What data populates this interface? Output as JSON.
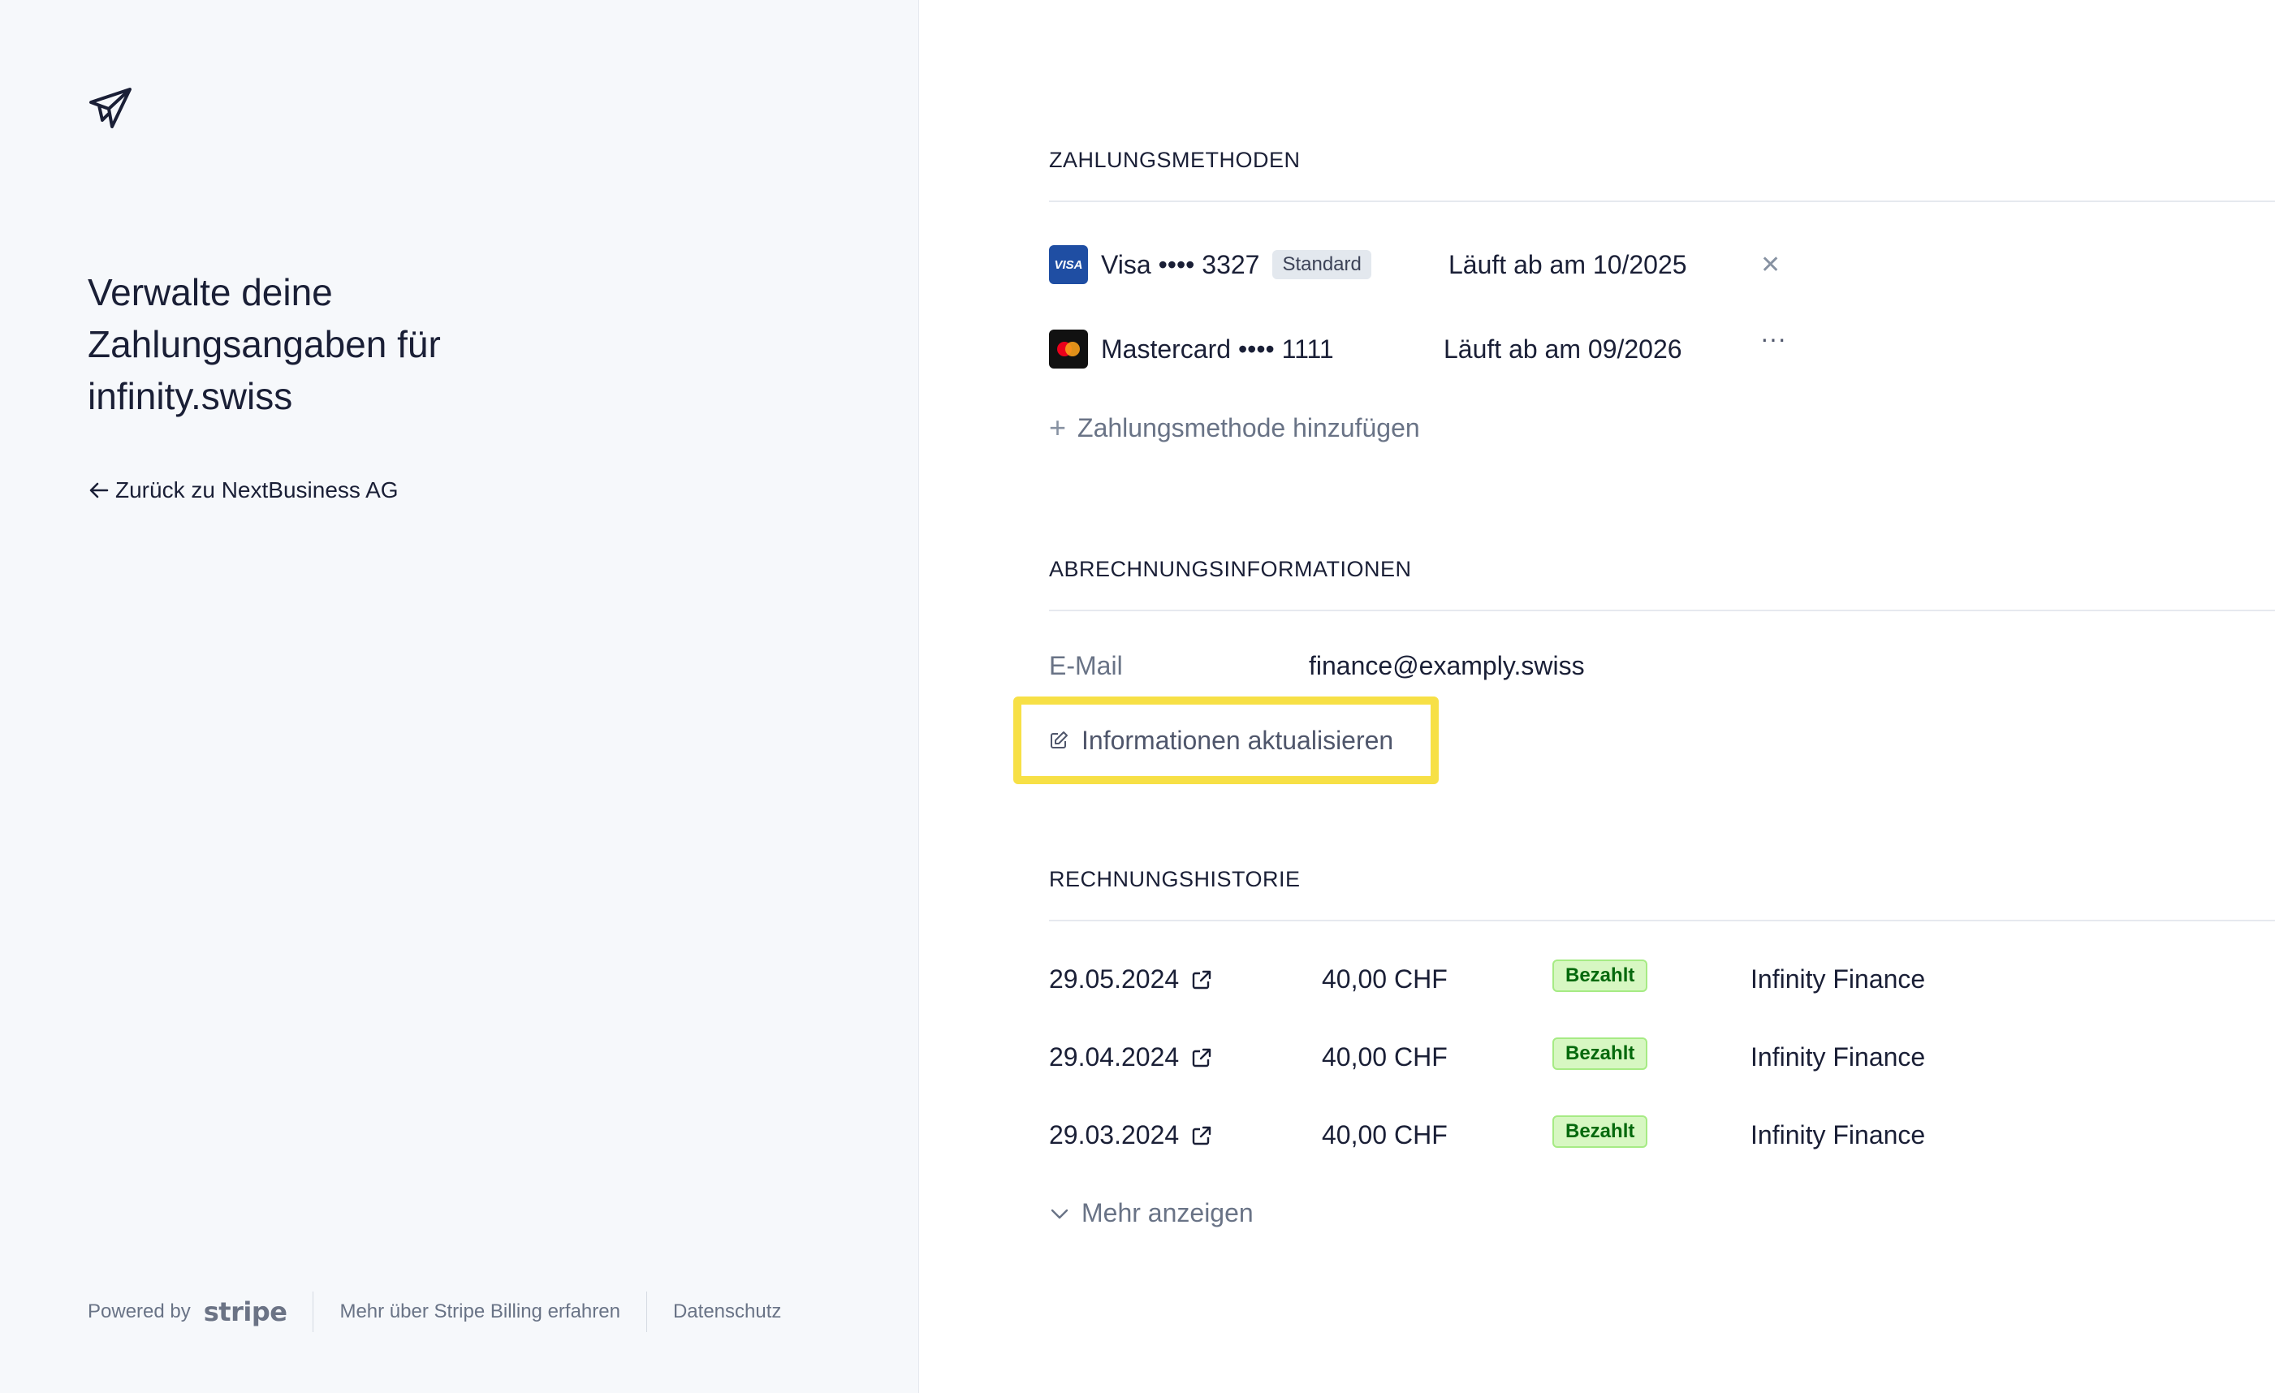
{
  "left": {
    "headline": "Verwalte deine Zahlungsangaben für infinity.swiss",
    "back_link": "Zurück zu NextBusiness AG",
    "footer": {
      "powered_by": "Powered by",
      "brand": "stripe",
      "learn_more": "Mehr über Stripe Billing erfahren",
      "privacy": "Datenschutz"
    }
  },
  "payment_methods": {
    "title": "ZAHLUNGSMETHODEN",
    "items": [
      {
        "brand_icon": "VISA",
        "name": "Visa •••• 3327",
        "badge": "Standard",
        "expiry": "Läuft ab am 10/2025",
        "action_icon": "close-icon",
        "action_glyph": "✕"
      },
      {
        "brand_icon": "mastercard",
        "name": "Mastercard •••• 1111",
        "badge": "",
        "expiry": "Läuft ab am 09/2026",
        "action_icon": "more-icon",
        "action_glyph": "···"
      }
    ],
    "add_label": "Zahlungsmethode hinzufügen"
  },
  "billing": {
    "title": "ABRECHNUNGSINFORMATIONEN",
    "email_label": "E-Mail",
    "email_value": "finance@examply.swiss",
    "update_label": "Informationen aktualisieren"
  },
  "invoices": {
    "title": "RECHNUNGSHISTORIE",
    "rows": [
      {
        "date": "29.05.2024",
        "amount": "40,00 CHF",
        "status": "Bezahlt",
        "company": "Infinity Finance"
      },
      {
        "date": "29.04.2024",
        "amount": "40,00 CHF",
        "status": "Bezahlt",
        "company": "Infinity Finance"
      },
      {
        "date": "29.03.2024",
        "amount": "40,00 CHF",
        "status": "Bezahlt",
        "company": "Infinity Finance"
      }
    ],
    "more_label": "Mehr anzeigen"
  },
  "colors": {
    "left_bg": "#f6f8fb",
    "highlight": "#f7e046",
    "status_bg": "#d7f7c2",
    "status_text": "#05690d"
  }
}
